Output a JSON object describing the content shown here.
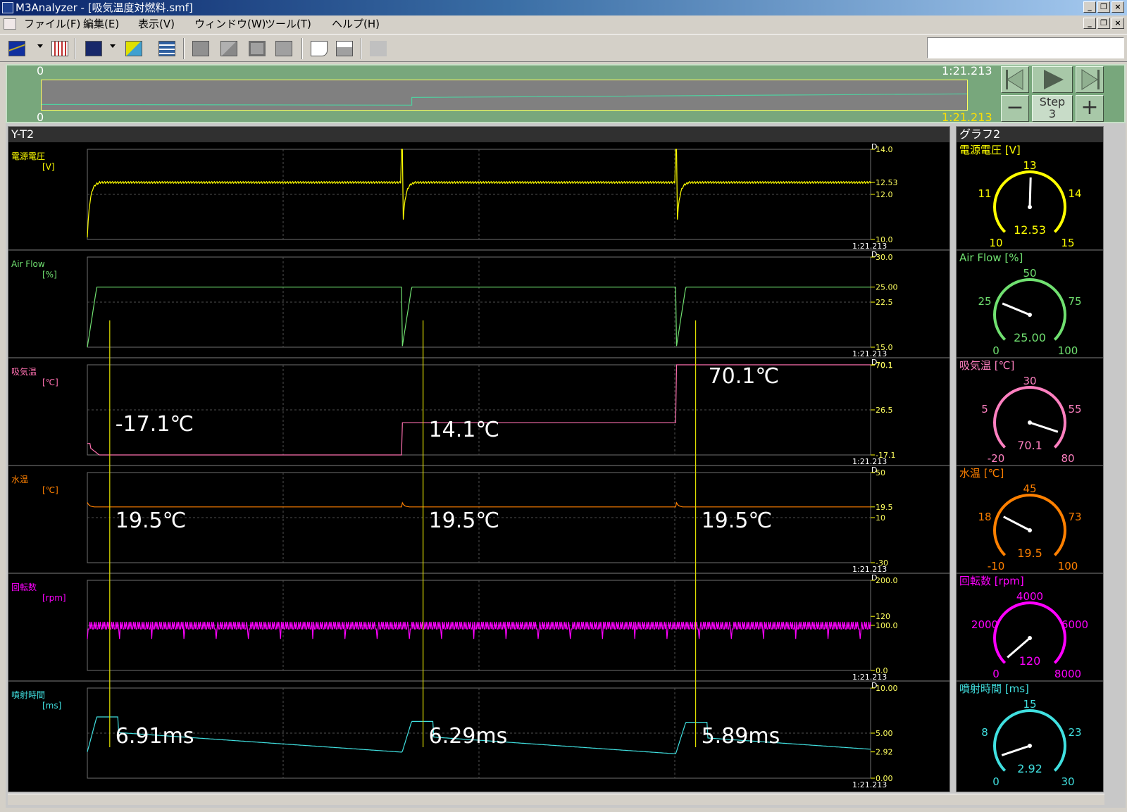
{
  "window": {
    "title": "M3Analyzer - [吸気温度対燃料.smf]"
  },
  "menu": [
    "ファイル(F)",
    "編集(E)",
    "表示(V)",
    "ウィンドウ(W)",
    "ツール(T)",
    "ヘルプ(H)"
  ],
  "toolbar_icons": [
    "yt-graph-icon",
    "waveform-icon",
    "xy-graph-icon",
    "cursor-icon",
    "data-table-icon",
    "stop-icon",
    "marker-icon",
    "frame-icon",
    "tzo-icon",
    "print-preview-icon",
    "print-icon",
    "plugin-icon"
  ],
  "navigator": {
    "start_top": "0",
    "end_top": "1:21.213",
    "start_bottom": "0",
    "end_bottom": "1:21.213",
    "step_label": "Step",
    "step_value": "3",
    "overview_fractions": [
      [
        0,
        0.82
      ],
      [
        0.4,
        0.84
      ],
      [
        0.4,
        0.58
      ],
      [
        1,
        0.46
      ]
    ]
  },
  "yt": {
    "title": "Y-T2",
    "time_end": "1:21.213",
    "d_marker": "D",
    "cursor_fractions": [
      0.025,
      0.425,
      0.773
    ],
    "channels": [
      {
        "name": "電源電圧",
        "unit": "[V]",
        "color": "#ffff00",
        "ticks": [
          "14.0",
          "12.53",
          "12.0",
          "10.0"
        ],
        "tick_values": [
          14,
          12.53,
          12,
          10
        ],
        "min": 10,
        "max": 14,
        "kind": "voltage",
        "base": 12.53,
        "annotations": []
      },
      {
        "name": "Air Flow",
        "unit": "[%]",
        "color": "#70e070",
        "ticks": [
          "30.0",
          "25.00",
          "22.5",
          "15.0"
        ],
        "tick_values": [
          30,
          25,
          22.5,
          15
        ],
        "min": 15,
        "max": 30,
        "kind": "airflow",
        "base": 25,
        "annotations": []
      },
      {
        "name": "吸気温",
        "unit": "[℃]",
        "color": "#ff70b0",
        "ticks": [
          "70.1",
          "70.1",
          "26.5",
          "-17.1"
        ],
        "tick_values": [
          70.6,
          69.8,
          26.5,
          -17.1
        ],
        "min": -17.1,
        "max": 70.1,
        "kind": "steps",
        "levels": [
          -17.1,
          14.1,
          70.1
        ],
        "annotations": [
          "-17.1℃",
          "14.1℃",
          "70.1℃"
        ]
      },
      {
        "name": "水温",
        "unit": "[℃]",
        "color": "#ff8000",
        "ticks": [
          "50",
          "19.5",
          "10",
          "-30"
        ],
        "tick_values": [
          50,
          19.5,
          10,
          -30
        ],
        "min": -30,
        "max": 50,
        "kind": "water",
        "base": 19.5,
        "annotations": [
          "19.5℃",
          "19.5℃",
          "19.5℃"
        ]
      },
      {
        "name": "回転数",
        "unit": "[rpm]",
        "color": "#ff00ff",
        "ticks": [
          "200.0",
          "120",
          "100.0",
          "0.0"
        ],
        "tick_values": [
          200,
          120,
          100,
          0
        ],
        "min": 0,
        "max": 200,
        "kind": "rpm",
        "base": 100,
        "annotations": []
      },
      {
        "name": "噴射時間",
        "unit": "[ms]",
        "color": "#40e0e0",
        "ticks": [
          "10.00",
          "5.00",
          "2.92",
          "0.00"
        ],
        "tick_values": [
          10,
          5,
          2.92,
          0
        ],
        "min": 0,
        "max": 10,
        "kind": "inject",
        "base": 2.92,
        "annotations": [
          "6.91ms",
          "6.29ms",
          "5.89ms"
        ]
      }
    ]
  },
  "gauges": {
    "title": "グラフ2",
    "items": [
      {
        "label": "電源電圧 [V]",
        "color": "#ffff00",
        "min": 10,
        "max": 15,
        "value": 12.53,
        "value_text": "12.53",
        "scale": [
          "10",
          "11",
          "13",
          "14",
          "15"
        ]
      },
      {
        "label": "Air Flow [%]",
        "color": "#70e070",
        "min": 0,
        "max": 100,
        "value": 25,
        "value_text": "25.00",
        "scale": [
          "0",
          "25",
          "50",
          "75",
          "100"
        ]
      },
      {
        "label": "吸気温 [℃]",
        "color": "#ff80c0",
        "min": -20,
        "max": 80,
        "value": 70.1,
        "value_text": "70.1",
        "scale": [
          "-20",
          "5",
          "30",
          "55",
          "80"
        ]
      },
      {
        "label": "水温 [℃]",
        "color": "#ff8000",
        "min": -10,
        "max": 100,
        "value": 19.5,
        "value_text": "19.5",
        "scale": [
          "-10",
          "18",
          "45",
          "73",
          "100"
        ]
      },
      {
        "label": "回転数 [rpm]",
        "color": "#ff00ff",
        "min": 0,
        "max": 8000,
        "value": 120,
        "value_text": "120",
        "scale": [
          "0",
          "2000",
          "4000",
          "6000",
          "8000"
        ]
      },
      {
        "label": "噴射時間 [ms]",
        "color": "#40e0e0",
        "min": 0,
        "max": 30,
        "value": 2.92,
        "value_text": "2.92",
        "scale": [
          "0",
          "8",
          "15",
          "23",
          "30"
        ]
      }
    ]
  }
}
